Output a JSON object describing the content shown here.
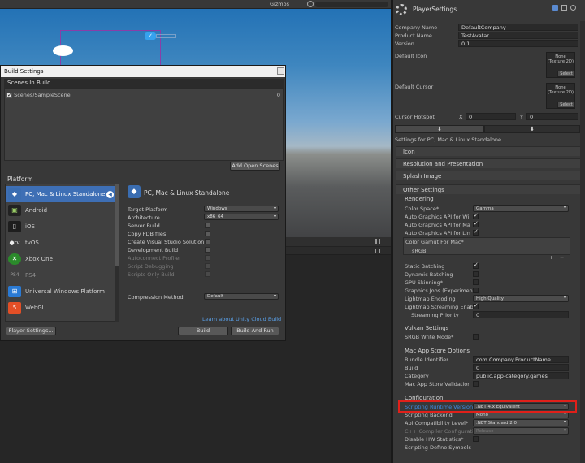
{
  "scene": {
    "gizmos": "Gizmos"
  },
  "build_settings": {
    "title": "Build Settings",
    "scenes_in_build_header": "Scenes In Build",
    "scenes": [
      {
        "path": "Scenes/SampleScene",
        "index": "0",
        "checked": true
      }
    ],
    "add_open_scenes": "Add Open Scenes",
    "platform_header": "Platform",
    "platforms": [
      {
        "name": "PC, Mac & Linux Standalone",
        "icon": "unity-logo-icon",
        "selected": true
      },
      {
        "name": "Android",
        "icon": "android-icon"
      },
      {
        "name": "iOS",
        "icon": "ios-icon"
      },
      {
        "name": "tvOS",
        "icon": "tvos-icon"
      },
      {
        "name": "Xbox One",
        "icon": "xbox-icon"
      },
      {
        "name": "PS4",
        "icon": "ps4-icon"
      },
      {
        "name": "Universal Windows Platform",
        "icon": "windows-icon"
      },
      {
        "name": "WebGL",
        "icon": "html5-icon"
      }
    ],
    "selected_platform": "PC, Mac & Linux Standalone",
    "options": {
      "target_platform": {
        "label": "Target Platform",
        "value": "Windows"
      },
      "architecture": {
        "label": "Architecture",
        "value": "x86_64"
      },
      "server_build": "Server Build",
      "copy_pdb": "Copy PDB files",
      "create_vs": "Create Visual Studio Solution",
      "development_build": "Development Build",
      "autoconnect_profiler": "Autoconnect Profiler",
      "script_debugging": "Script Debugging",
      "scripts_only": "Scripts Only Build",
      "compression": {
        "label": "Compression Method",
        "value": "Default"
      }
    },
    "cloud_link": "Learn about Unity Cloud Build",
    "player_settings_btn": "Player Settings...",
    "build_btn": "Build",
    "build_and_run_btn": "Build And Run"
  },
  "inspector": {
    "title": "PlayerSettings",
    "company_name": {
      "label": "Company Name",
      "value": "DefaultCompany"
    },
    "product_name": {
      "label": "Product Name",
      "value": "TestAvatar"
    },
    "version": {
      "label": "Version",
      "value": "0.1"
    },
    "default_icon": {
      "label": "Default Icon",
      "slot_line1": "None",
      "slot_line2": "(Texture 2D)",
      "select": "Select"
    },
    "default_cursor": {
      "label": "Default Cursor",
      "slot_line1": "None",
      "slot_line2": "(Texture 2D)",
      "select": "Select"
    },
    "cursor_hotspot": {
      "label": "Cursor Hotspot",
      "x_label": "X",
      "x": "0",
      "y_label": "Y",
      "y": "0"
    },
    "settings_for": "Settings for PC, Mac & Linux Standalone",
    "foldouts": {
      "icon": "Icon",
      "resolution": "Resolution and Presentation",
      "splash": "Splash Image",
      "other": "Other Settings"
    },
    "rendering": {
      "header": "Rendering",
      "color_space": {
        "label": "Color Space*",
        "value": "Gamma"
      },
      "api_win": "Auto Graphics API  for Wi",
      "api_mac": "Auto Graphics API  for Ma",
      "api_linux": "Auto Graphics API  for Lin",
      "gamut_header": "Color Gamut For Mac*",
      "gamut_item": "sRGB",
      "static_batching": "Static Batching",
      "dynamic_batching": "Dynamic Batching",
      "gpu_skinning": "GPU Skinning*",
      "graphics_jobs": "Graphics Jobs (Experimen",
      "lightmap_encoding": {
        "label": "Lightmap Encoding",
        "value": "High Quality"
      },
      "lightmap_streaming": "Lightmap Streaming Enab",
      "streaming_priority": {
        "label": "Streaming Priority",
        "value": "0"
      }
    },
    "vulkan": {
      "header": "Vulkan Settings",
      "srgb_write": "SRGB Write Mode*"
    },
    "mac_store": {
      "header": "Mac App Store Options",
      "bundle_id": {
        "label": "Bundle Identifier",
        "value": "com.Company.ProductName"
      },
      "build": {
        "label": "Build",
        "value": "0"
      },
      "category": {
        "label": "Category",
        "value": "public.app-category.games"
      },
      "receipt_validation": "Mac App Store Validation"
    },
    "configuration": {
      "header": "Configuration",
      "runtime_version": {
        "label": "Scripting Runtime Version",
        "value": ".NET 4.x Equivalent"
      },
      "scripting_backend": {
        "label": "Scripting Backend",
        "value": "Mono"
      },
      "api_compat": {
        "label": "Api Compatibility Level*",
        "value": ".NET Standard 2.0"
      },
      "cpp_config": {
        "label": "C++ Compiler Configurati",
        "value": "Release"
      },
      "disable_hw_stats": "Disable HW Statistics*",
      "define_symbols": "Scripting Define Symbols"
    }
  },
  "colors": {
    "highlight": "#e0201a",
    "selection": "#3e6fb5",
    "link": "#5aa0e8"
  }
}
